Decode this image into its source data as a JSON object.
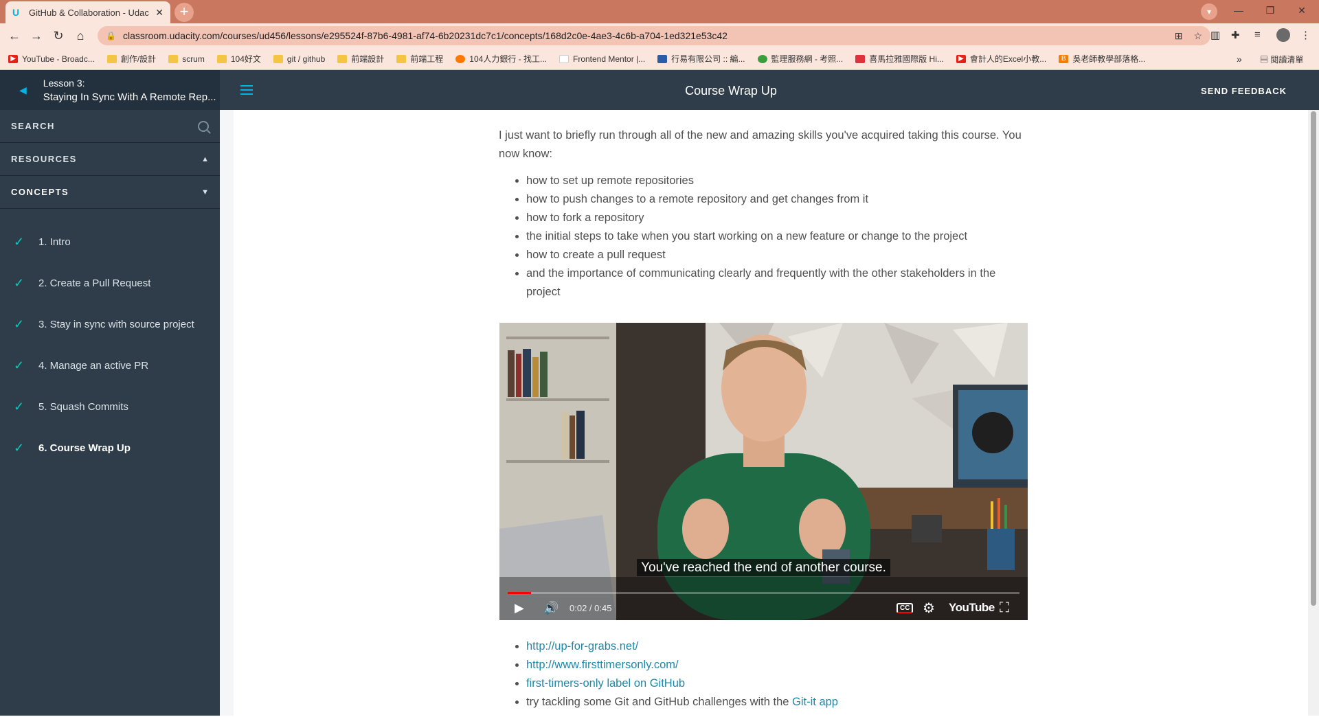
{
  "browser": {
    "tab_title": "GitHub & Collaboration - Udac",
    "url": "classroom.udacity.com/courses/ud456/lessons/e295524f-87b6-4981-af74-6b20231dc7c1/concepts/168d2c0e-4ae3-4c6b-a704-1ed321e53c42",
    "bookmarks": [
      {
        "label": "YouTube - Broadc...",
        "color": "#e62117",
        "icon": "youtube-icon"
      },
      {
        "label": "創作/設計",
        "color": "#f4c542",
        "icon": "folder-icon"
      },
      {
        "label": "scrum",
        "color": "#f4c542",
        "icon": "folder-icon"
      },
      {
        "label": "104好文",
        "color": "#f4c542",
        "icon": "folder-icon"
      },
      {
        "label": "git / github",
        "color": "#f4c542",
        "icon": "folder-icon"
      },
      {
        "label": "前端設計",
        "color": "#f4c542",
        "icon": "folder-icon"
      },
      {
        "label": "前端工程",
        "color": "#f4c542",
        "icon": "folder-icon"
      },
      {
        "label": "104人力銀行 - 找工...",
        "color": "#ff7800",
        "icon": "site-icon"
      },
      {
        "label": "Frontend Mentor |...",
        "color": "#ffffff",
        "icon": "site-icon"
      },
      {
        "label": "行易有限公司 :: 編...",
        "color": "#2b5ca8",
        "icon": "site-icon"
      },
      {
        "label": "監理服務網 - 考照...",
        "color": "#3c9d3c",
        "icon": "site-icon"
      },
      {
        "label": "喜馬拉雅國際版 Hi...",
        "color": "#e0323c",
        "icon": "site-icon"
      },
      {
        "label": "會計人的Excel小教...",
        "color": "#e62117",
        "icon": "youtube-icon"
      },
      {
        "label": "吳老師教學部落格...",
        "color": "#f57d00",
        "icon": "blogger-icon"
      }
    ],
    "reading_list": "閱讀清單"
  },
  "sidebar": {
    "lesson_number": "Lesson 3:",
    "lesson_name": "Staying In Sync With A Remote Rep...",
    "search_label": "SEARCH",
    "resources_label": "RESOURCES",
    "concepts_label": "CONCEPTS",
    "concepts": [
      {
        "label": "1. Intro"
      },
      {
        "label": "2. Create a Pull Request"
      },
      {
        "label": "3. Stay in sync with source project"
      },
      {
        "label": "4. Manage an active PR"
      },
      {
        "label": "5. Squash Commits"
      },
      {
        "label": "6. Course Wrap Up"
      }
    ]
  },
  "header": {
    "title": "Course Wrap Up",
    "feedback": "SEND FEEDBACK"
  },
  "article": {
    "intro": "I just want to briefly run through all of the new and amazing skills you've acquired taking this course. You now know:",
    "skills": [
      "how to set up remote repositories",
      "how to push changes to a remote repository and get changes from it",
      "how to fork a repository",
      "the initial steps to take when you start working on a new feature or change to the project",
      "how to create a pull request",
      "and the importance of communicating clearly and frequently with the other stakeholders in the project"
    ]
  },
  "video": {
    "caption": "You've reached the end of another course.",
    "time": "0:02 / 0:45",
    "progress": 0.045,
    "youtube_label": "YouTube"
  },
  "links": {
    "link1": "http://up-for-grabs.net/",
    "link2": "http://www.firsttimersonly.com/",
    "link3": "first-timers-only label on GitHub",
    "last_prefix": "try tackling some Git and GitHub challenges with the ",
    "last_link": "Git-it app"
  }
}
